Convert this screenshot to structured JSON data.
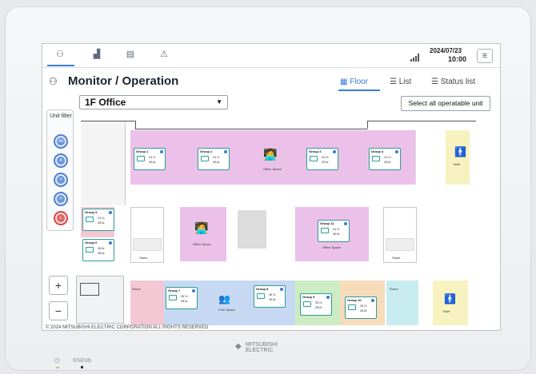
{
  "header": {
    "date": "2024/07/23",
    "time": "10:00",
    "tabs": [
      {
        "icon": "binoculars-icon",
        "glyph": "⚇",
        "active": true
      },
      {
        "icon": "energy-chart-icon",
        "glyph": "▟"
      },
      {
        "icon": "schedule-icon",
        "glyph": "▤"
      },
      {
        "icon": "warning-icon",
        "glyph": "⚠"
      }
    ],
    "menu_glyph": "≡"
  },
  "page": {
    "title": "Monitor / Operation",
    "title_icon": "⚇",
    "view_tabs": [
      {
        "label": "Floor",
        "glyph": "▦",
        "active": true
      },
      {
        "label": "List",
        "glyph": "☰"
      },
      {
        "label": "Status list",
        "glyph": "☰"
      }
    ],
    "floor": "1F  Office",
    "select_all": "Select all operatable unit"
  },
  "filter": {
    "label": "Unit filter",
    "items": [
      "All",
      "A",
      "V",
      "H",
      "L"
    ]
  },
  "zoom": {
    "plus": "+",
    "minus": "−"
  },
  "map": {
    "colors": {
      "office": "#ebc1ea",
      "hall": "#c7d9f2",
      "green": "#ccecc3",
      "orange": "#f6dcbb",
      "yellow": "#f7f2bf",
      "cyan": "#c8ecef",
      "pink": "#f3c7d3",
      "gray": "#dcdcdc"
    },
    "groups": [
      {
        "name": "Group 1",
        "t1": "24.7c",
        "t2": "28.0c"
      },
      {
        "name": "Group 2",
        "t1": "24.7c",
        "t2": "28.0c"
      },
      {
        "name": "Group 3",
        "t1": "24.7c",
        "t2": "28.0c"
      },
      {
        "name": "Group 4",
        "t1": "24.7c",
        "t2": "28.0c"
      },
      {
        "name": "Group 5",
        "t1": "24.7c",
        "t2": "28.0c"
      },
      {
        "name": "Group 6",
        "t1": "28.0c",
        "t2": "28.0c"
      },
      {
        "name": "Group 7",
        "t1": "28.7c",
        "t2": "28.0c"
      },
      {
        "name": "Group 8",
        "t1": "28.7c",
        "t2": "28.0c"
      },
      {
        "name": "Group 9",
        "t1": "28.7c",
        "t2": "28.0c"
      },
      {
        "name": "Group 10",
        "t1": "28.7c",
        "t2": "28.0c"
      },
      {
        "name": "Group 11",
        "t1": "24.7c",
        "t2": "28.0c"
      }
    ],
    "labels": {
      "office_space": "Office Space",
      "free_space": "Free Space",
      "toilet": "Toilet",
      "stairs": "Stairs",
      "room": "Room"
    }
  },
  "copyright": "© 2024 MITSUBISHI ELECTRIC CORPORATION ALL RIGHTS RESERVED",
  "device": {
    "brand_line1": "MITSUBISHI",
    "brand_line2": "ELECTRIC",
    "power_glyph": "⏻",
    "status": "STATUS"
  }
}
